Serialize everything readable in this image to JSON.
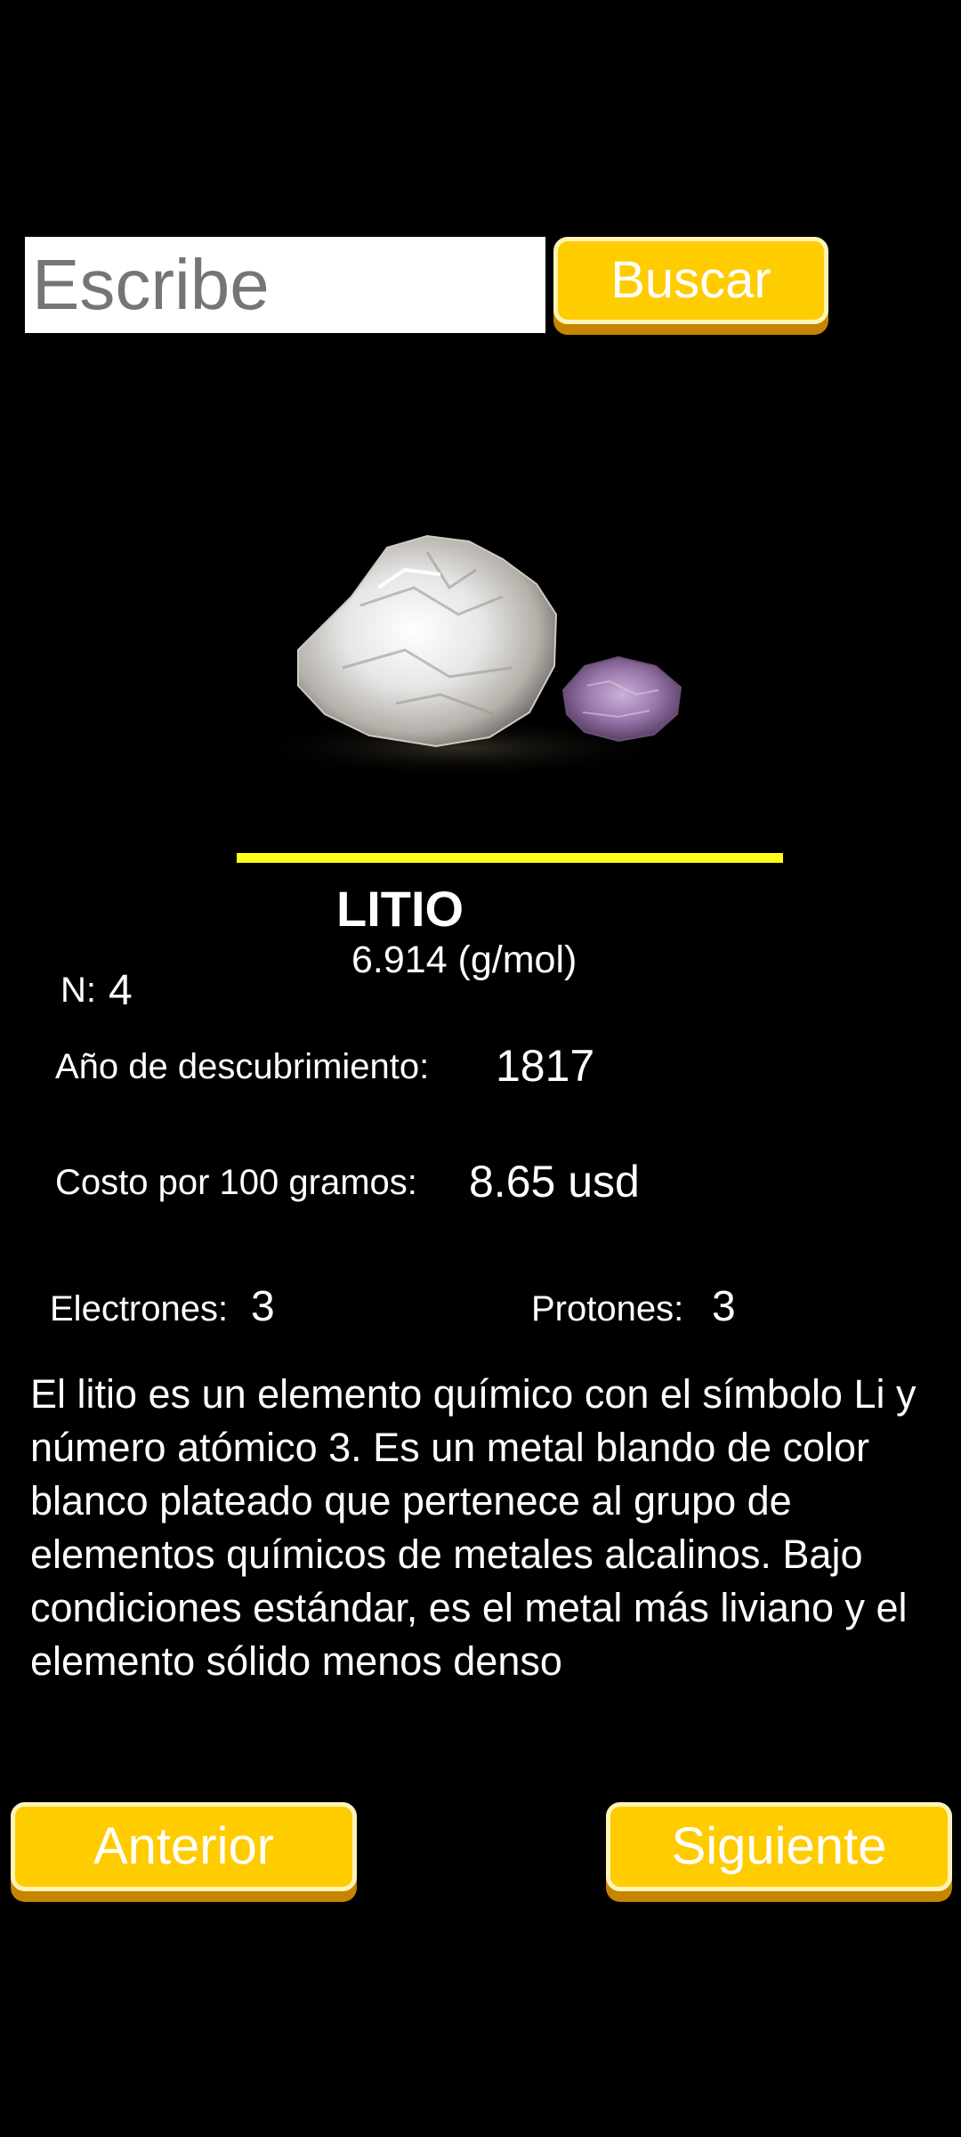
{
  "search": {
    "placeholder": "Escribe",
    "button_label": "Buscar"
  },
  "element": {
    "image": "lithium-mineral-photo",
    "name": "LITIO",
    "atomic_mass": "6.914 (g/mol)",
    "n_label": "N:",
    "n_value": "4",
    "year_label": "Año de descubrimiento:",
    "year_value": "1817",
    "cost_label": "Costo por 100 gramos:",
    "cost_value": "8.65 usd",
    "electrons_label": "Electrones:",
    "electrons_value": "3",
    "protons_label": "Protones:",
    "protons_value": "3",
    "description": "El litio es un elemento químico con el símbolo Li y número atómico 3. Es un metal blando de color blanco plateado que pertenece al grupo de elementos químicos de metales alcalinos. Bajo condiciones estándar, es el metal más liviano y el elemento sólido menos denso"
  },
  "navigation": {
    "prev_label": "Anterior",
    "next_label": "Siguiente"
  },
  "colors": {
    "background": "#000000",
    "button_fill": "#ffcc00",
    "button_shadow": "#c68400",
    "divider": "#ffff1a",
    "text": "#ffffff"
  }
}
